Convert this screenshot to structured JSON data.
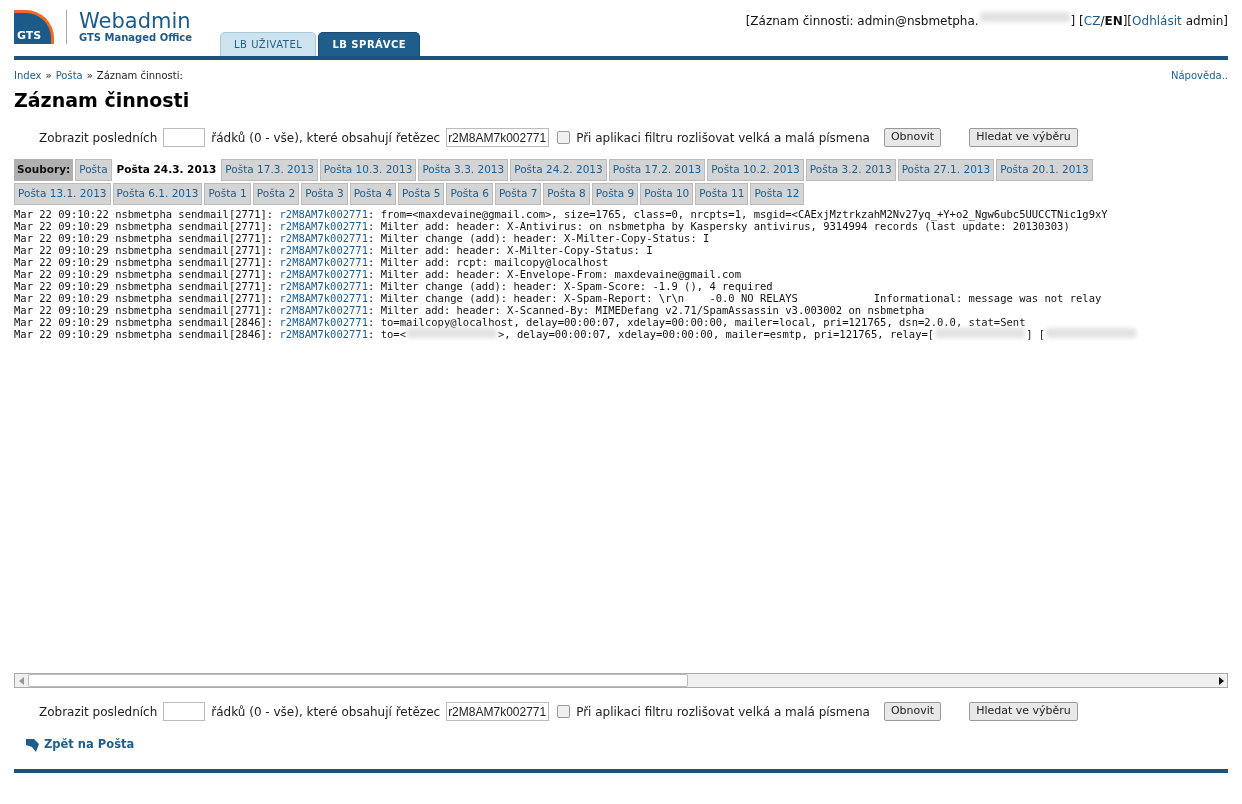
{
  "header": {
    "logo_badge": "GTS",
    "logo_title": "Webadmin",
    "logo_subtitle": "GTS Managed Office",
    "tabs": [
      {
        "label": "LB UŽIVATEL",
        "selected": false
      },
      {
        "label": "LB SPRÁVCE",
        "selected": true
      }
    ],
    "session": {
      "prefix": "[Záznam činnosti: admin@nsbmetpha.",
      "suffix": "] [",
      "lang_cz": "CZ",
      "lang_sep": "/",
      "lang_en": "EN",
      "bracket": "][",
      "logout": "Odhlásit",
      "user": "admin]"
    }
  },
  "breadcrumb": [
    {
      "label": "Index",
      "kind": "link"
    },
    {
      "label": "»",
      "kind": "text"
    },
    {
      "label": "Pošta",
      "kind": "link"
    },
    {
      "label": "»",
      "kind": "text"
    },
    {
      "label": "Záznam činnosti:",
      "kind": "text"
    }
  ],
  "help": "Nápověda..",
  "title": "Záznam činnosti",
  "filters": [
    {
      "label_before": "Zobrazit posledních",
      "label_middle": "řádků (0 - vše), které obsahují řetězec",
      "search": "r2M8AM7k002771",
      "case_sensitive": false,
      "case_label": "Při aplikaci filtru rozlišovat velká a malá písmena",
      "refresh": "Obnovit",
      "search_button": "Hledat ve výběru"
    },
    {
      "label_before": "Zobrazit posledních",
      "label_middle": "řádků (0 - vše), které obsahují řetězec",
      "search": "r2M8AM7k002771",
      "case_sensitive": false,
      "case_label": "Při aplikaci filtru rozlišovat velká a malá písmena",
      "refresh": "Obnovit",
      "search_button": "Hledat ve výběru"
    }
  ],
  "files_label": "Soubory:",
  "files": [
    {
      "label": "Pošta",
      "selected": false
    },
    {
      "label": "Pošta 24.3. 2013",
      "selected": true
    },
    {
      "label": "Pošta 17.3. 2013",
      "selected": false
    },
    {
      "label": "Pošta 10.3. 2013",
      "selected": false
    },
    {
      "label": "Pošta 3.3. 2013",
      "selected": false
    },
    {
      "label": "Pošta 24.2. 2013",
      "selected": false
    },
    {
      "label": "Pošta 17.2. 2013",
      "selected": false
    },
    {
      "label": "Pošta 10.2. 2013",
      "selected": false
    },
    {
      "label": "Pošta 3.2. 2013",
      "selected": false
    },
    {
      "label": "Pošta 27.1. 2013",
      "selected": false
    },
    {
      "label": "Pošta 20.1. 2013",
      "selected": false
    },
    {
      "label": "Pošta 13.1. 2013",
      "selected": false
    },
    {
      "label": "Pošta 6.1. 2013",
      "selected": false
    },
    {
      "label": "Pošta 1",
      "selected": false
    },
    {
      "label": "Pošta 2",
      "selected": false
    },
    {
      "label": "Pošta 3",
      "selected": false
    },
    {
      "label": "Pošta 4",
      "selected": false
    },
    {
      "label": "Pošta 5",
      "selected": false
    },
    {
      "label": "Pošta 6",
      "selected": false
    },
    {
      "label": "Pošta 7",
      "selected": false
    },
    {
      "label": "Pošta 8",
      "selected": false
    },
    {
      "label": "Pošta 9",
      "selected": false
    },
    {
      "label": "Pošta 10",
      "selected": false
    },
    {
      "label": "Pošta 11",
      "selected": false
    },
    {
      "label": "Pošta 12",
      "selected": false
    }
  ],
  "log": [
    {
      "prefix": "Mar 22 09:10:22 nsbmetpha sendmail[2771]: ",
      "id": "r2M8AM7k002771",
      "message": [
        {
          "kind": "text",
          "text": ": from=<maxdevaine@gmail.com>, size=1765, class=0, nrcpts=1, msgid=<CAExjMztrkzahM2Nv27yq_+Y+o2_Ngw6ubc5UUCCTNic1g9xY"
        }
      ]
    },
    {
      "prefix": "Mar 22 09:10:29 nsbmetpha sendmail[2771]: ",
      "id": "r2M8AM7k002771",
      "message": [
        {
          "kind": "text",
          "text": ": Milter add: header: X-Antivirus: on nsbmetpha by Kaspersky antivirus, 9314994 records (last update: 20130303)"
        }
      ]
    },
    {
      "prefix": "Mar 22 09:10:29 nsbmetpha sendmail[2771]: ",
      "id": "r2M8AM7k002771",
      "message": [
        {
          "kind": "text",
          "text": ": Milter change (add): header: X-Milter-Copy-Status: I"
        }
      ]
    },
    {
      "prefix": "Mar 22 09:10:29 nsbmetpha sendmail[2771]: ",
      "id": "r2M8AM7k002771",
      "message": [
        {
          "kind": "text",
          "text": ": Milter add: header: X-Milter-Copy-Status: I"
        }
      ]
    },
    {
      "prefix": "Mar 22 09:10:29 nsbmetpha sendmail[2771]: ",
      "id": "r2M8AM7k002771",
      "message": [
        {
          "kind": "text",
          "text": ": Milter add: rcpt: mailcopy@localhost"
        }
      ]
    },
    {
      "prefix": "Mar 22 09:10:29 nsbmetpha sendmail[2771]: ",
      "id": "r2M8AM7k002771",
      "message": [
        {
          "kind": "text",
          "text": ": Milter add: header: X-Envelope-From: maxdevaine@gmail.com"
        }
      ]
    },
    {
      "prefix": "Mar 22 09:10:29 nsbmetpha sendmail[2771]: ",
      "id": "r2M8AM7k002771",
      "message": [
        {
          "kind": "text",
          "text": ": Milter change (add): header: X-Spam-Score: -1.9 (), 4 required"
        }
      ]
    },
    {
      "prefix": "Mar 22 09:10:29 nsbmetpha sendmail[2771]: ",
      "id": "r2M8AM7k002771",
      "message": [
        {
          "kind": "text",
          "text": ": Milter change (add): header: X-Spam-Report: \\r\\n    -0.0 NO RELAYS            Informational: message was not relay"
        }
      ]
    },
    {
      "prefix": "Mar 22 09:10:29 nsbmetpha sendmail[2771]: ",
      "id": "r2M8AM7k002771",
      "message": [
        {
          "kind": "text",
          "text": ": Milter add: header: X-Scanned-By: MIMEDefang v2.71/SpamAssassin v3.003002 on nsbmetpha"
        }
      ]
    },
    {
      "prefix": "Mar 22 09:10:29 nsbmetpha sendmail[2846]: ",
      "id": "r2M8AM7k002771",
      "message": [
        {
          "kind": "text",
          "text": ": to=mailcopy@localhost, delay=00:00:07, xdelay=00:00:00, mailer=local, pri=121765, dsn=2.0.0, stat=Sent"
        }
      ]
    },
    {
      "prefix": "Mar 22 09:10:29 nsbmetpha sendmail[2846]: ",
      "id": "r2M8AM7k002771",
      "message": [
        {
          "kind": "text",
          "text": ": to=<"
        },
        {
          "kind": "blurred"
        },
        {
          "kind": "text",
          "text": ">, delay=00:00:07, xdelay=00:00:00, mailer=esmtp, pri=121765, relay=["
        },
        {
          "kind": "blurred"
        },
        {
          "kind": "text",
          "text": "] ["
        },
        {
          "kind": "blurred"
        }
      ]
    }
  ],
  "back": "Zpět na Pošta"
}
